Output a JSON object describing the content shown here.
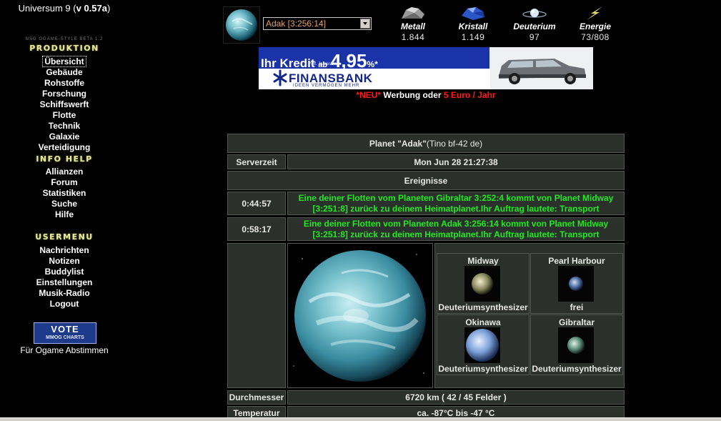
{
  "version": {
    "prefix": "Universum 9 (",
    "bold": "v",
    "number": " 0.57a",
    "suffix": ")"
  },
  "style_beta": "NSG OGAME-STYLE BETA 1.2",
  "sections": {
    "produktion": "PRODUKTION",
    "info_help": "INFO HELP",
    "usermenu": "USERMENU"
  },
  "menu": {
    "produktion": [
      "Übersicht",
      "Gebäude",
      "Rohstoffe",
      "Forschung",
      "Schiffswerft",
      "Flotte",
      "Technik",
      "Galaxie",
      "Verteidigung"
    ],
    "info": [
      "Allianzen",
      "Forum",
      "Statistiken",
      "Suche",
      "Hilfe"
    ],
    "user": [
      "Nachrichten",
      "Notizen",
      "Buddylist",
      "Einstellungen",
      "Musik-Radio",
      "Logout"
    ]
  },
  "vote": {
    "line1": "VOTE",
    "line2": "MMOG CHARTS",
    "caption": "Für Ogame Abstimmen"
  },
  "planet_select": "Adak [3:256:14]",
  "resources": [
    {
      "name": "Metall",
      "value": "1.844",
      "icon": "metal-icon"
    },
    {
      "name": "Kristall",
      "value": "1.149",
      "icon": "crystal-icon"
    },
    {
      "name": "Deuterium",
      "value": "97",
      "icon": "deuterium-icon"
    },
    {
      "name": "Energie",
      "value": "73/808",
      "icon": "energy-icon"
    }
  ],
  "ad": {
    "kredit": "Ihr Kredit",
    "ab": "ab",
    "rate": "4,95",
    "pct": "%*",
    "eff": "*eff. Jahreszins",
    "bank": "FINANSBANK",
    "slogan": "IDEEN VERMÖGEN MEHR",
    "caption_new": "*NEU*",
    "caption_mid": " Werbung oder ",
    "caption_price": "5 Euro / Jahr"
  },
  "overview": {
    "title_prefix": "Planet \"Adak\"",
    "title_suffix": " (Tino bf-42 de)",
    "serverzeit_label": "Serverzeit",
    "serverzeit": "Mon Jun 28 21:27:38",
    "ereignisse": "Ereignisse",
    "events": [
      {
        "time": "0:44:57",
        "text": "Eine deiner Flotten vom Planeten Gibraltar 3:252:4 kommt von Planet Midway [3:251:8] zurück zu deinem Heimatplanet.Ihr Auftrag lautete: Transport"
      },
      {
        "time": "0:58:17",
        "text": "Eine deiner Flotten vom Planeten Adak 3:256:14 kommt von Planet Midway [3:251:8] zurück zu deinem Heimatplanet.Ihr Auftrag lautete: Transport"
      }
    ],
    "other_planets": [
      {
        "name": "Midway",
        "status": "Deuteriumsynthesizer"
      },
      {
        "name": "Pearl Harbour",
        "status": "frei"
      },
      {
        "name": "Okinawa",
        "status": "Deuteriumsynthesizer"
      },
      {
        "name": "Gibraltar",
        "status": "Deuteriumsynthesizer"
      }
    ],
    "durchmesser_label": "Durchmesser",
    "durchmesser": "6720 km ( 42 / 45 Felder )",
    "temperatur_label": "Temperatur",
    "temperatur": "ca. -87°C bis -47 °C"
  }
}
